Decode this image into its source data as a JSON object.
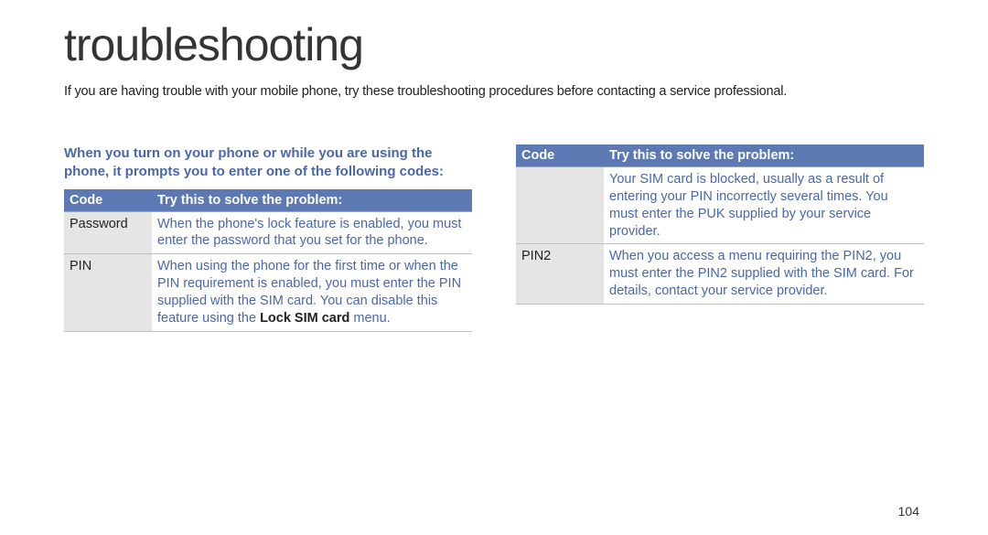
{
  "title": "troubleshooting",
  "intro": "If you are having trouble with your mobile phone, try these troubleshooting procedures before contacting a service professional.",
  "heading": "When you turn on your phone or while you are using the phone, it prompts you to enter one of the following codes:",
  "headers": {
    "code": "Code",
    "try": "Try this to solve the problem:"
  },
  "leftRows": [
    {
      "code": "Password",
      "desc": "When the phone's lock feature is enabled, you must enter the password that you set for the phone."
    },
    {
      "code": "PIN",
      "desc_pre": "When using the phone for the first time or when the PIN requirement is enabled, you must enter the PIN supplied with the SIM card. You can disable this feature using the ",
      "desc_emph": "Lock SIM card",
      "desc_post": " menu."
    }
  ],
  "rightRows": [
    {
      "code": "",
      "desc": "Your SIM card is blocked, usually as a result of entering your PIN incorrectly several times. You must enter the PUK supplied by your service provider."
    },
    {
      "code": "PIN2",
      "desc": "When you access a menu requiring the PIN2, you must enter the PIN2 supplied with the SIM card. For details, contact your service provider."
    }
  ],
  "pageNumber": "104"
}
